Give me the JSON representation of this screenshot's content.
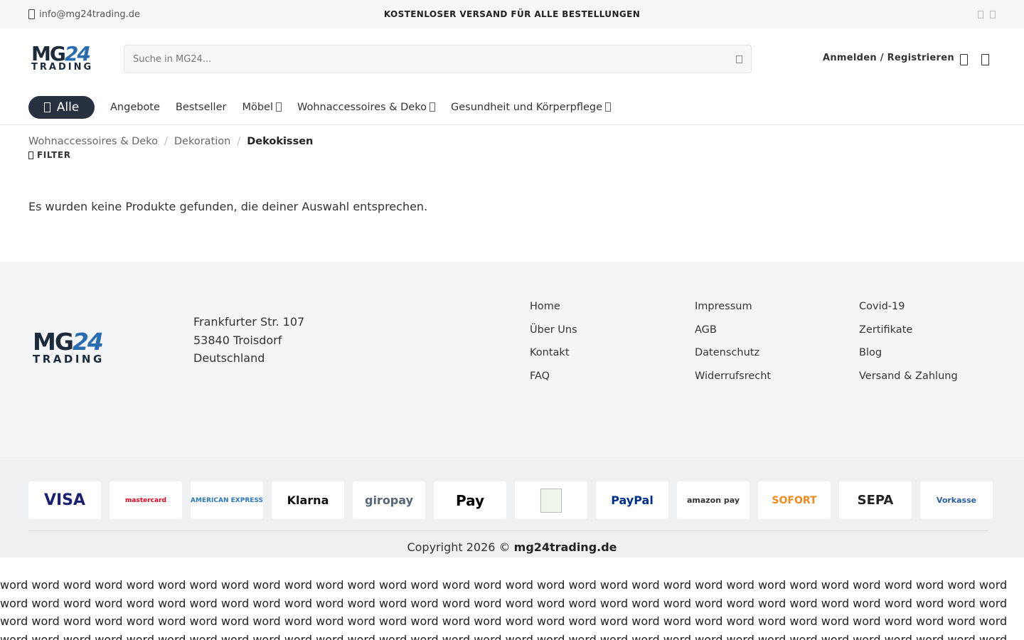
{
  "topbar": {
    "email": "info@mg24trading.de",
    "promo": "KOSTENLOSER VERSAND FÜR ALLE BESTELLUNGEN",
    "icons": [
      "mail-icon",
      "facebook-icon",
      "instagram-icon"
    ]
  },
  "header": {
    "logo": {
      "mg": "MG",
      "num": "24",
      "sub": "TRADING"
    },
    "search_placeholder": "Suche in MG24...",
    "account_label": "Anmelden / Registrieren",
    "icons": [
      "search-icon",
      "wishlist-icon",
      "cart-icon"
    ]
  },
  "nav": {
    "all_label": "Alle",
    "items": [
      {
        "label": "Angebote",
        "dropdown": false
      },
      {
        "label": "Bestseller",
        "dropdown": false
      },
      {
        "label": "Möbel",
        "dropdown": true
      },
      {
        "label": "Wohnaccessoires & Deko",
        "dropdown": true
      },
      {
        "label": "Gesundheit und Körperpflege",
        "dropdown": true
      }
    ]
  },
  "breadcrumb": {
    "items": [
      "Wohnaccessoires & Deko",
      "Dekoration"
    ],
    "current": "Dekokissen",
    "separator": "/"
  },
  "filter_label": "FILTER",
  "no_results": "Es wurden keine Produkte gefunden, die deiner Auswahl entsprechen.",
  "footer": {
    "address": [
      "Frankfurter Str. 107",
      "53840 Troisdorf",
      "Deutschland"
    ],
    "columns": [
      [
        "Home",
        "Über Uns",
        "Kontakt",
        "FAQ"
      ],
      [
        "Impressum",
        "AGB",
        "Datenschutz",
        "Widerrufsrecht"
      ],
      [
        "Covid-19",
        "Zertifikate",
        "Blog",
        "Versand & Zahlung"
      ]
    ],
    "payments": [
      {
        "label": "VISA",
        "color": "#1a1f71"
      },
      {
        "label": "mastercard",
        "color": "#eb001b"
      },
      {
        "label": "AMERICAN EXPRESS",
        "color": "#2e77bc"
      },
      {
        "label": "Klarna",
        "color": "#111111"
      },
      {
        "label": "giropay",
        "color": "#5a6677"
      },
      {
        "label": "Pay",
        "color": "#000000"
      },
      {
        "label": "",
        "color": "#6aa84f"
      },
      {
        "label": "PayPal",
        "color": "#003087"
      },
      {
        "label": "amazon pay",
        "color": "#333333"
      },
      {
        "label": "SOFORT",
        "color": "#ef8a1f"
      },
      {
        "label": "SEPA",
        "color": "#222222"
      },
      {
        "label": "Vorkasse",
        "color": "#2a5e9e"
      }
    ],
    "copyright_prefix": "Copyright 2026 ©",
    "copyright_site": "mg24trading.de"
  },
  "filler_word": "word"
}
